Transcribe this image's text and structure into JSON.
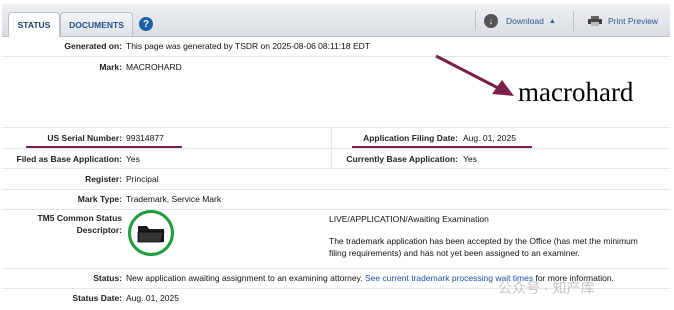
{
  "tabs": [
    {
      "label": "STATUS"
    },
    {
      "label": "DOCUMENTS"
    }
  ],
  "toolbar": {
    "help_label": "?",
    "download_label": "Download",
    "print_label": "Print Preview"
  },
  "rows": {
    "generated": {
      "label": "Generated on:",
      "value": "This page was generated by TSDR on 2025-08-06 08:11:18 EDT"
    },
    "mark": {
      "label": "Mark:",
      "value": "MACROHARD",
      "image_text": "macrohard"
    },
    "serial": {
      "label": "US Serial Number:",
      "value": "99314877"
    },
    "filing": {
      "label": "Application Filing Date:",
      "value": "Aug. 01, 2025"
    },
    "filed_base": {
      "label": "Filed as Base Application:",
      "value": "Yes"
    },
    "current_base": {
      "label": "Currently Base Application:",
      "value": "Yes"
    },
    "register": {
      "label": "Register:",
      "value": "Principal"
    },
    "mark_type": {
      "label": "Mark Type:",
      "value": "Trademark, Service Mark"
    },
    "tm5": {
      "label1": "TM5 Common Status",
      "label2": "Descriptor:",
      "status_title": "LIVE/APPLICATION/Awaiting Examination",
      "desc_line1": "The trademark application has been accepted by the Office (has met the minimum",
      "desc_line2": "filing requirements) and has not yet been assigned to an examiner."
    },
    "status": {
      "label": "Status:",
      "value": "New application awaiting assignment to an examining attorney.",
      "link": "See current trademark processing wait times",
      "tail": "for more information."
    },
    "status_date": {
      "label": "Status Date:",
      "value": "Aug. 01, 2025"
    }
  },
  "watermark": "公众号 · 知产库",
  "colors": {
    "annotation": "#7a1f4a",
    "circle": "#1e9d3a",
    "link": "#1f4fa8"
  }
}
